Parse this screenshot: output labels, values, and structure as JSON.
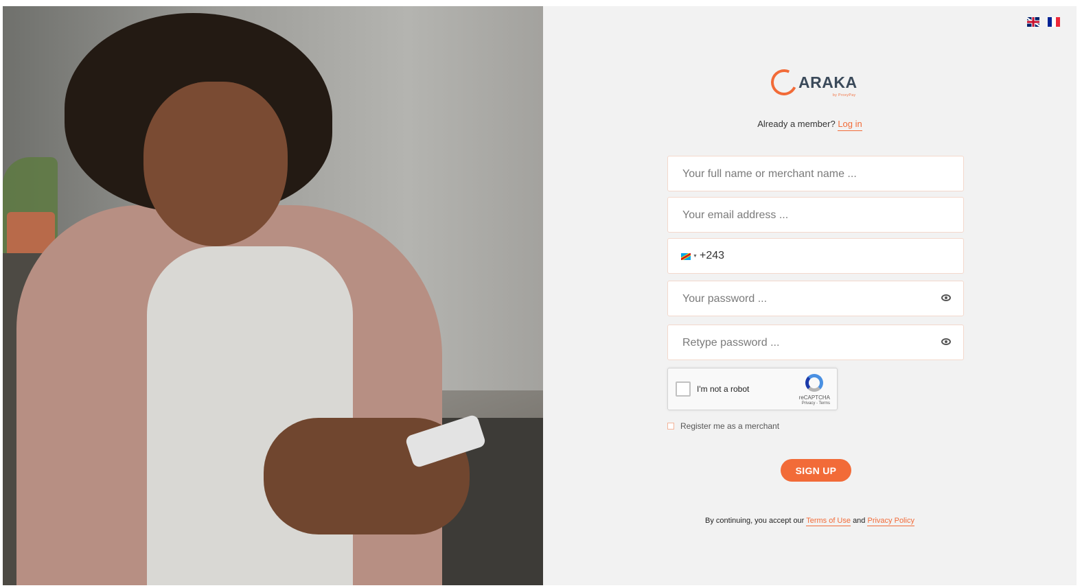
{
  "language": {
    "options": [
      {
        "code": "en",
        "icon": "uk-flag-icon"
      },
      {
        "code": "fr",
        "icon": "france-flag-icon"
      }
    ]
  },
  "brand": {
    "name": "ARAKA",
    "sub": "by ProxyPay",
    "accent_color": "#f26b38",
    "text_color": "#3b4a5a"
  },
  "member": {
    "prompt": "Already a member?",
    "login_link": "Log in"
  },
  "form": {
    "full_name": {
      "placeholder": "Your full name or merchant name ..."
    },
    "email": {
      "placeholder": "Your email address ..."
    },
    "phone": {
      "country_icon": "drc-flag-icon",
      "code": "+243"
    },
    "password": {
      "placeholder": "Your password ..."
    },
    "retype_password": {
      "placeholder": "Retype password ..."
    },
    "captcha": {
      "label": "I'm not a robot",
      "brand": "reCAPTCHA",
      "links": "Privacy - Terms"
    },
    "merchant_label": "Register me as a merchant",
    "submit_label": "SIGN UP"
  },
  "terms": {
    "prefix": "By continuing, you accept our",
    "terms_link": "Terms of Use",
    "conjunction": "and",
    "privacy_link": "Privacy Policy"
  }
}
